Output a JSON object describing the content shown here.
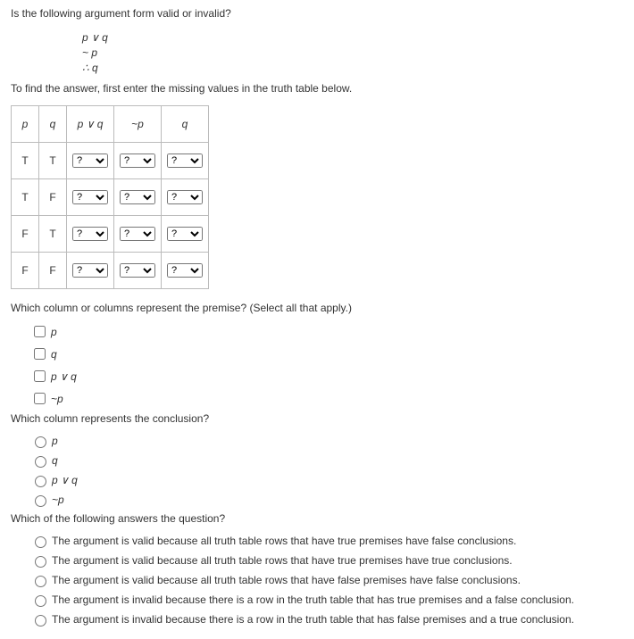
{
  "question_intro": "Is the following argument form valid or invalid?",
  "argument": {
    "line1": "p ∨ q",
    "line2": "~ p",
    "line3": "∴ q"
  },
  "instruction": "To find the answer, first enter the missing values in the truth table below.",
  "table": {
    "headers": {
      "p": "p",
      "q": "q",
      "pvq": "p ∨ q",
      "np": "~p",
      "qc": "q"
    },
    "rows": [
      {
        "p": "T",
        "q": "T"
      },
      {
        "p": "T",
        "q": "F"
      },
      {
        "p": "F",
        "q": "T"
      },
      {
        "p": "F",
        "q": "F"
      }
    ],
    "select_placeholder": "?"
  },
  "premise_q": "Which column or columns represent the premise? (Select all that apply.)",
  "premise_options": {
    "p": "p",
    "q": "q",
    "pvq": "p ∨ q",
    "np": "~p"
  },
  "conclusion_q": "Which column represents the conclusion?",
  "conclusion_options": {
    "p": "p",
    "q": "q",
    "pvq": "p ∨ q",
    "np": "~p"
  },
  "final_q": "Which of the following answers the question?",
  "final_options": {
    "a": "The argument is valid because all truth table rows that have true premises have false conclusions.",
    "b": "The argument is valid because all truth table rows that have true premises have true conclusions.",
    "c": "The argument is valid because all truth table rows that have false premises have false conclusions.",
    "d": "The argument is invalid because there is a row in the truth table that has true premises and a false conclusion.",
    "e": "The argument is invalid because there is a row in the truth table that has false premises and a true conclusion."
  }
}
